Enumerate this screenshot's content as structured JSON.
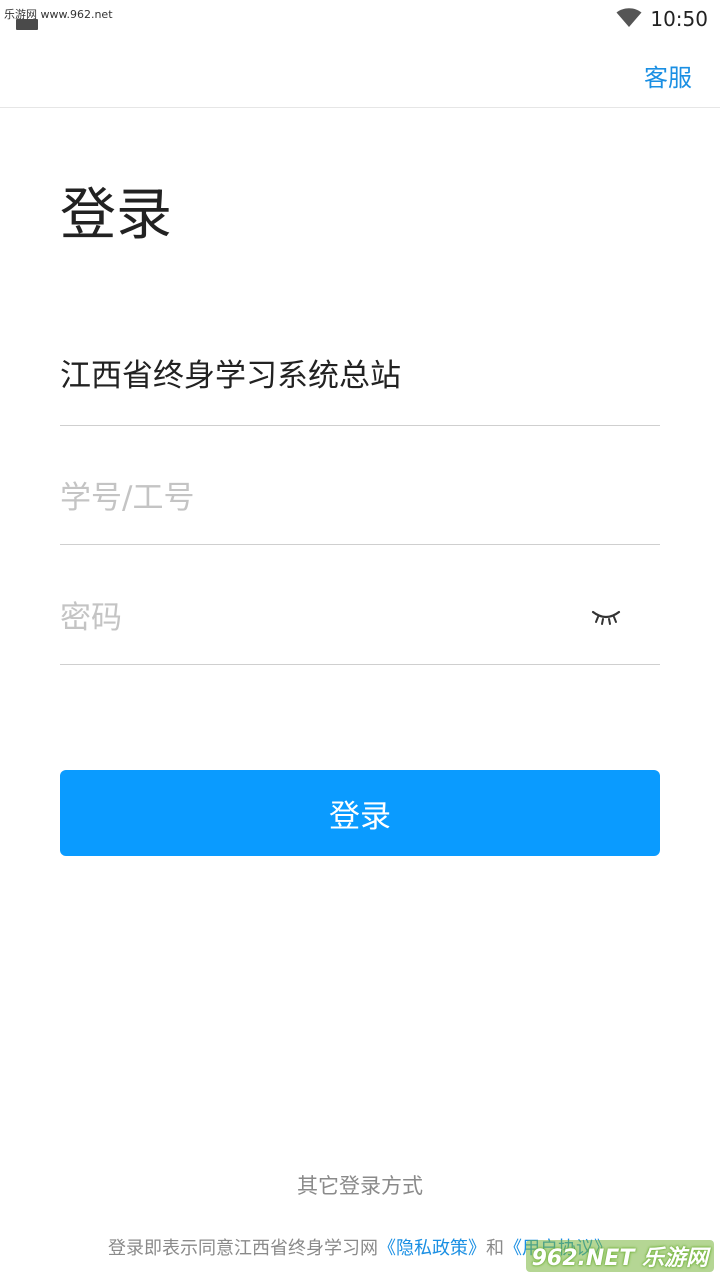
{
  "status_bar": {
    "watermark": "乐游网 www.962.net",
    "time": "10:50",
    "wifi_icon": "wifi-icon"
  },
  "app_bar": {
    "service_label": "客服"
  },
  "page": {
    "title": "登录"
  },
  "form": {
    "organization": "江西省终身学习系统总站",
    "account_placeholder": "学号/工号",
    "account_value": "",
    "password_placeholder": "密码",
    "password_value": "",
    "password_toggle_icon": "eye-closed-icon",
    "submit_label": "登录"
  },
  "footer": {
    "other_login": "其它登录方式",
    "agreement_prefix": "登录即表示同意江西省终身学习网",
    "privacy_link": "《隐私政策》",
    "agreement_and": "和",
    "user_agreement_link": "《用户协议》"
  },
  "watermark_bottom": "962.NET 乐游网",
  "colors": {
    "accent": "#0a9bff",
    "link": "#1a8fe3"
  }
}
